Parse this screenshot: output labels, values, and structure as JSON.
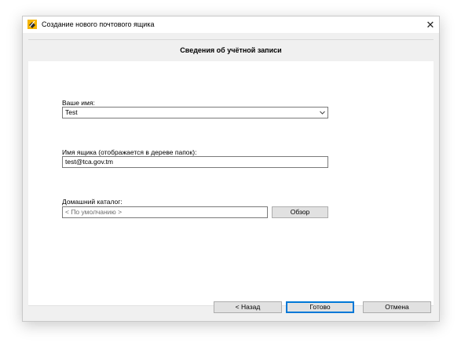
{
  "window": {
    "title": "Создание нового почтового ящика",
    "close_glyph": "✕"
  },
  "header": {
    "title": "Сведения об учётной записи"
  },
  "form": {
    "name_label": "Ваше имя:",
    "name_value": "Test",
    "mailbox_label": "Имя ящика (отображается в дереве папок):",
    "mailbox_value": "test@tca.gov.tm",
    "home_label": "Домашний каталог:",
    "home_placeholder": "< По умолчанию >",
    "browse_label": "Обзор"
  },
  "footer": {
    "back_label": "< Назад",
    "finish_label": "Готово",
    "cancel_label": "Отмена"
  },
  "colors": {
    "accent": "#0078d7",
    "window_bg": "#f0f0f0",
    "icon_yellow": "#f5b400"
  },
  "icons": [
    "app-icon",
    "close-icon",
    "chevron-down-icon"
  ]
}
